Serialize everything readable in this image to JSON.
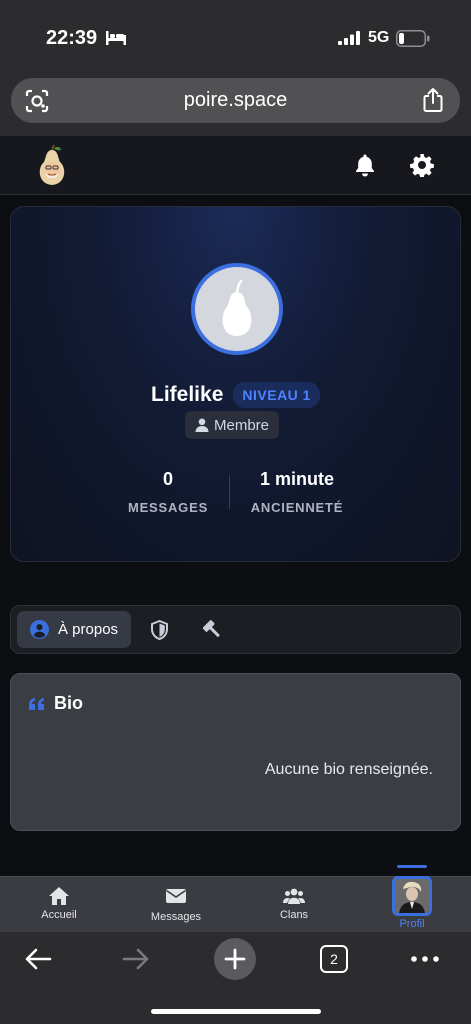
{
  "status_bar": {
    "time": "22:39",
    "network": "5G"
  },
  "browser": {
    "url": "poire.space",
    "tab_count": "2"
  },
  "profile": {
    "username": "Lifelike",
    "level_badge": "NIVEAU 1",
    "role": "Membre",
    "stats": [
      {
        "value": "0",
        "label": "MESSAGES"
      },
      {
        "value": "1 minute",
        "label": "ANCIENNETÉ"
      }
    ]
  },
  "tabs": {
    "active_label": "À propos"
  },
  "bio": {
    "title": "Bio",
    "empty_text": "Aucune bio renseignée."
  },
  "app_nav": {
    "items": [
      {
        "label": "Accueil"
      },
      {
        "label": "Messages"
      },
      {
        "label": "Clans"
      },
      {
        "label": "Profil"
      }
    ]
  },
  "colors": {
    "accent": "#3b6fe0",
    "badge_text": "#4d82ff",
    "card_bg": "#3a3d44"
  }
}
